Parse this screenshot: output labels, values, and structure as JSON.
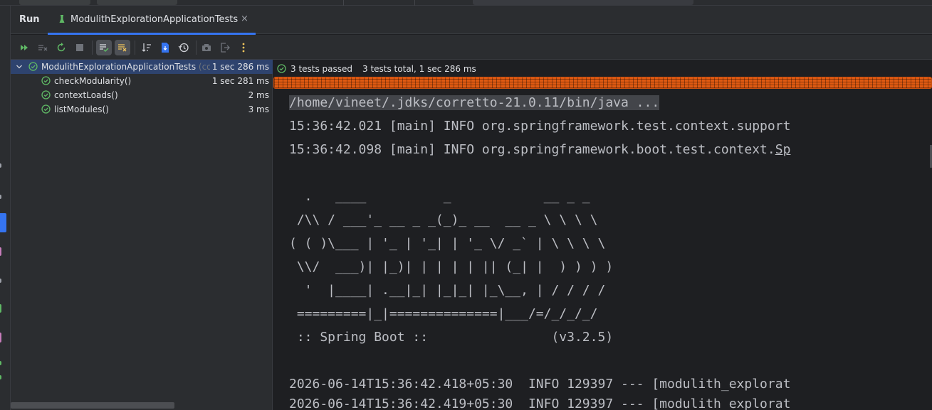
{
  "header": {
    "run_label": "Run",
    "tab_title": "ModulithExplorationApplicationTests",
    "tab_close": "×"
  },
  "toolbar": {
    "buttons": [
      "rerun-failed-icon",
      "stop-rerun-icon",
      "rerun-icon",
      "stop-icon",
      "show-passed-icon",
      "show-ignored-icon",
      "sort-icon",
      "import-tests-icon",
      "history-icon",
      "screenshot-icon",
      "export-icon",
      "more-icon"
    ]
  },
  "tree": {
    "root": {
      "name": "ModulithExplorationApplicationTests",
      "hint": "(com",
      "duration": "1 sec 286 ms"
    },
    "tests": [
      {
        "name": "checkModularity()",
        "duration": "1 sec 281 ms"
      },
      {
        "name": "contextLoads()",
        "duration": "2 ms"
      },
      {
        "name": "listModules()",
        "duration": "3 ms"
      }
    ]
  },
  "status": {
    "passed": "3 tests passed",
    "total": "3 tests total, 1 sec 286 ms",
    "progress_fraction": 1.0
  },
  "console": {
    "lines": [
      "/home/vineet/.jdks/corretto-21.0.11/bin/java ...",
      "15:36:42.021 [main] INFO org.springframework.test.context.support",
      "15:36:42.098 [main] INFO org.springframework.boot.test.context.",
      "",
      "  .   ____          _            __ _ _",
      " /\\\\ / ___'_ __ _ _(_)_ __  __ _ \\ \\ \\ \\",
      "( ( )\\___ | '_ | '_| | '_ \\/ _` | \\ \\ \\ \\",
      " \\\\/  ___)| |_)| | | | | || (_| |  ) ) ) )",
      "  '  |____| .__|_| |_|_| |_\\__, | / / / /",
      " =========|_|==============|___/=/_/_/_/",
      " :: Spring Boot ::                (v3.2.5)",
      "",
      "2026-06-14T15:36:42.418+05:30  INFO 129397 --- [modulith_explorat",
      "2026-06-14T15:36:42.419+05:30  INFO 129397 --- [modulith_explorat"
    ],
    "line2_tail": "Sp"
  },
  "colors": {
    "accent": "#3574f0",
    "success": "#5fb865",
    "progress": "#e05a12"
  }
}
